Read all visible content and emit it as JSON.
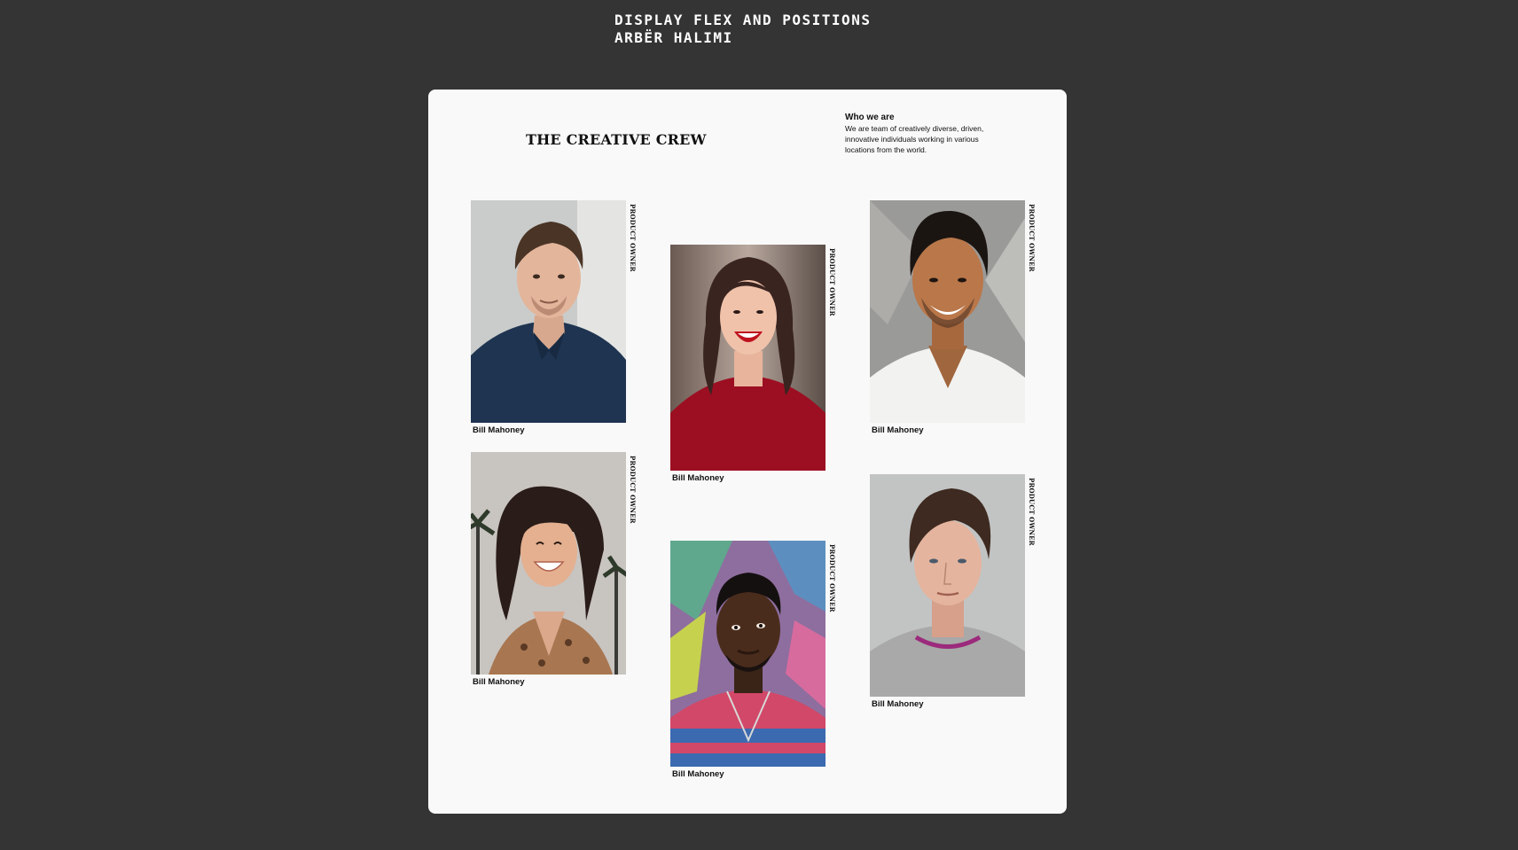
{
  "header": {
    "line1": "DISPLAY FLEX AND POSITIONS",
    "line2": "ARBËR HALIMI"
  },
  "card": {
    "title": "THE CREATIVE CREW",
    "about_title": "Who we are",
    "about_text": "We are team of creatively diverse, driven, innovative individuals working in various locations from the world."
  },
  "members": [
    {
      "name": "Bill Mahoney",
      "role": "PRODUCT OWNER"
    },
    {
      "name": "Bill Mahoney",
      "role": "PRODUCT OWNER"
    },
    {
      "name": "Bill Mahoney",
      "role": "PRODUCT OWNER"
    },
    {
      "name": "Bill Mahoney",
      "role": "PRODUCT OWNER"
    },
    {
      "name": "Bill Mahoney",
      "role": "PRODUCT OWNER"
    },
    {
      "name": "Bill Mahoney",
      "role": "PRODUCT OWNER"
    }
  ],
  "colors": {
    "page_background": "#343434",
    "card_background": "#f9f9f9",
    "text": "#111111"
  }
}
